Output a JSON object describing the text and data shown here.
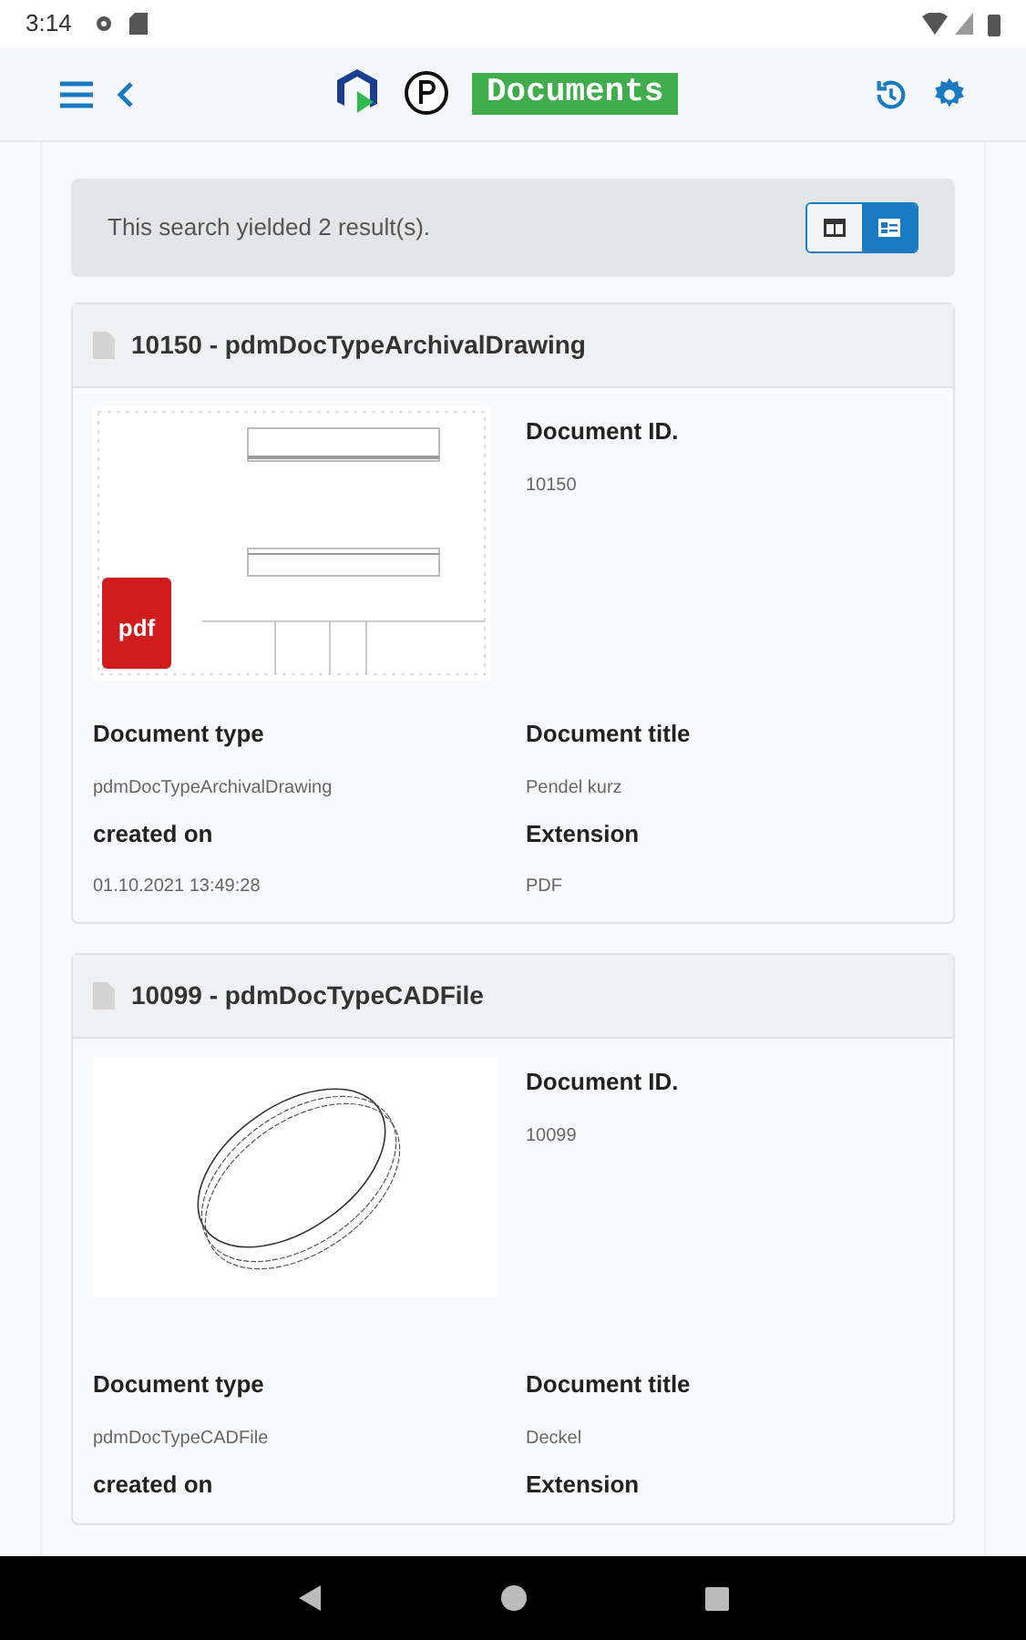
{
  "status_bar": {
    "time": "3:14"
  },
  "app_bar": {
    "title": "Documents"
  },
  "results": {
    "message": "This search yielded 2 result(s).",
    "view_toggle": [
      {
        "kind": "table",
        "selected": false
      },
      {
        "kind": "cards",
        "selected": true
      }
    ]
  },
  "documents": [
    {
      "heading": "10150 - pdmDocTypeArchivalDrawing",
      "kind": "drawing",
      "pdf_badge": "pdf",
      "fields": [
        {
          "label": "Document ID.",
          "value": "10150"
        },
        {
          "label": "Document type",
          "value": "pdmDocTypeArchivalDrawing"
        },
        {
          "label": "Document title",
          "value": "Pendel kurz"
        },
        {
          "label": "created on",
          "value": "01.10.2021 13:49:28"
        },
        {
          "label": "Extension",
          "value": "PDF"
        }
      ]
    },
    {
      "heading": "10099 - pdmDocTypeCADFile",
      "kind": "cad",
      "fields": [
        {
          "label": "Document ID.",
          "value": "10099"
        },
        {
          "label": "Document type",
          "value": "pdmDocTypeCADFile"
        },
        {
          "label": "Document title",
          "value": "Deckel"
        },
        {
          "label": "created on"
        },
        {
          "label": "Extension"
        }
      ]
    }
  ]
}
